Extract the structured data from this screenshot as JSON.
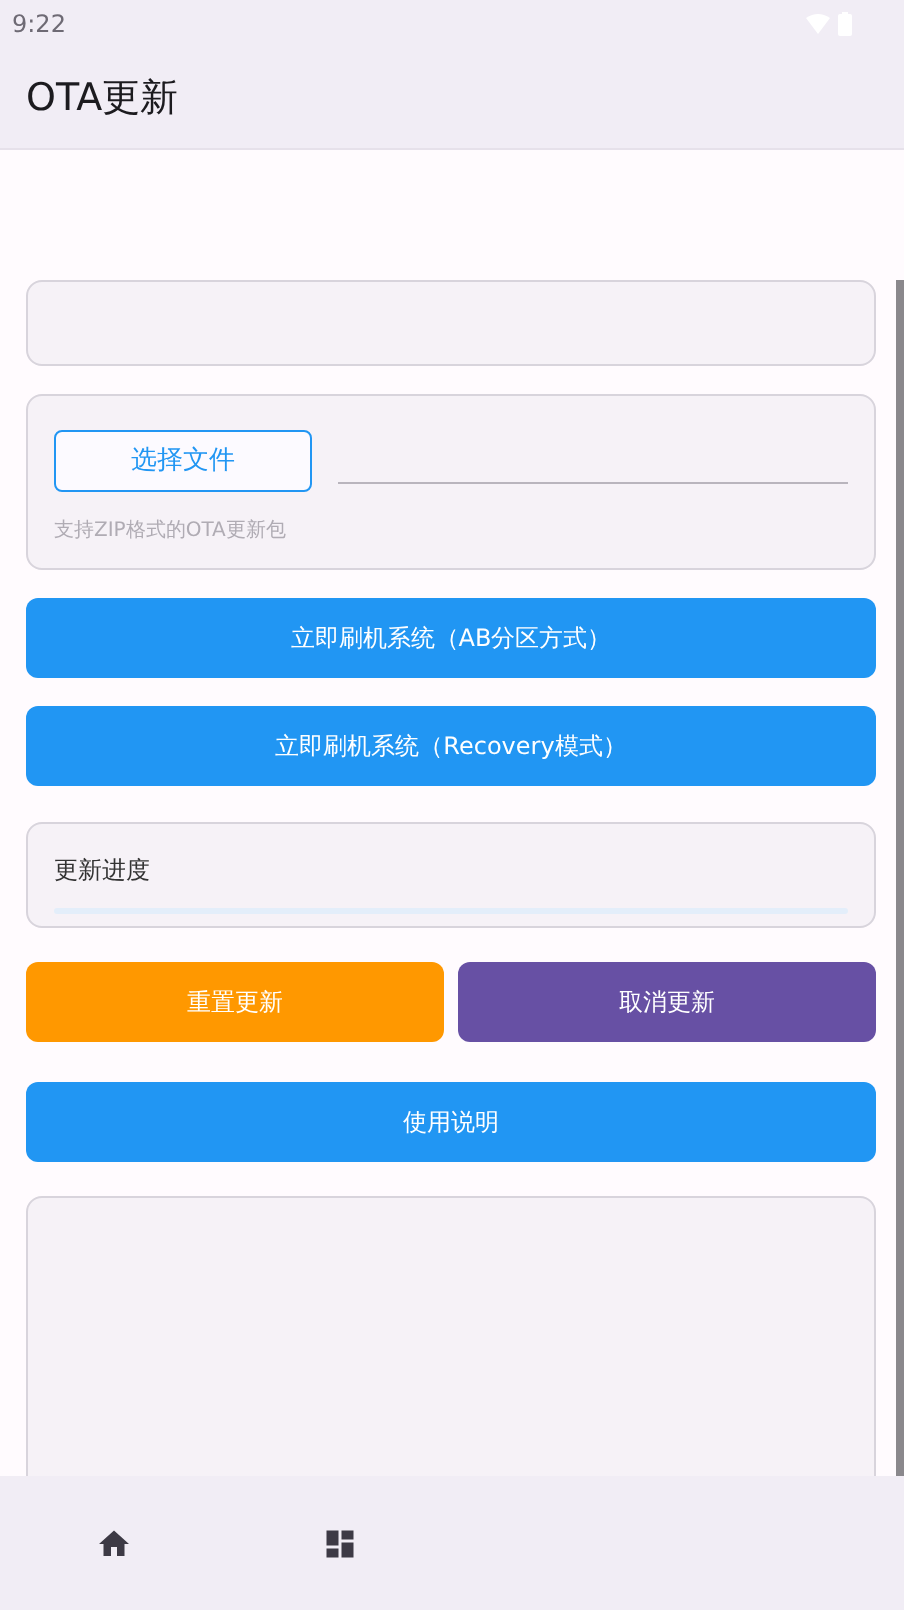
{
  "status_bar": {
    "time": "9:22"
  },
  "app_bar": {
    "title": "OTA更新"
  },
  "file_picker": {
    "button": "选择文件",
    "hint": "支持ZIP格式的OTA更新包"
  },
  "actions": [
    {
      "label": "立即刷机系统（AB分区方式）"
    },
    {
      "label": "立即刷机系统（Recovery模式）"
    }
  ],
  "progress": {
    "label": "更新进度",
    "level": 0
  },
  "row_buttons": [
    {
      "label": "重置更新",
      "color": "#ff9800"
    },
    {
      "label": "取消更新",
      "color": "#6750a4"
    }
  ],
  "help_button": {
    "label": "使用说明"
  },
  "bottom_nav": [
    {
      "kind": "home"
    },
    {
      "kind": "dashboard"
    }
  ]
}
